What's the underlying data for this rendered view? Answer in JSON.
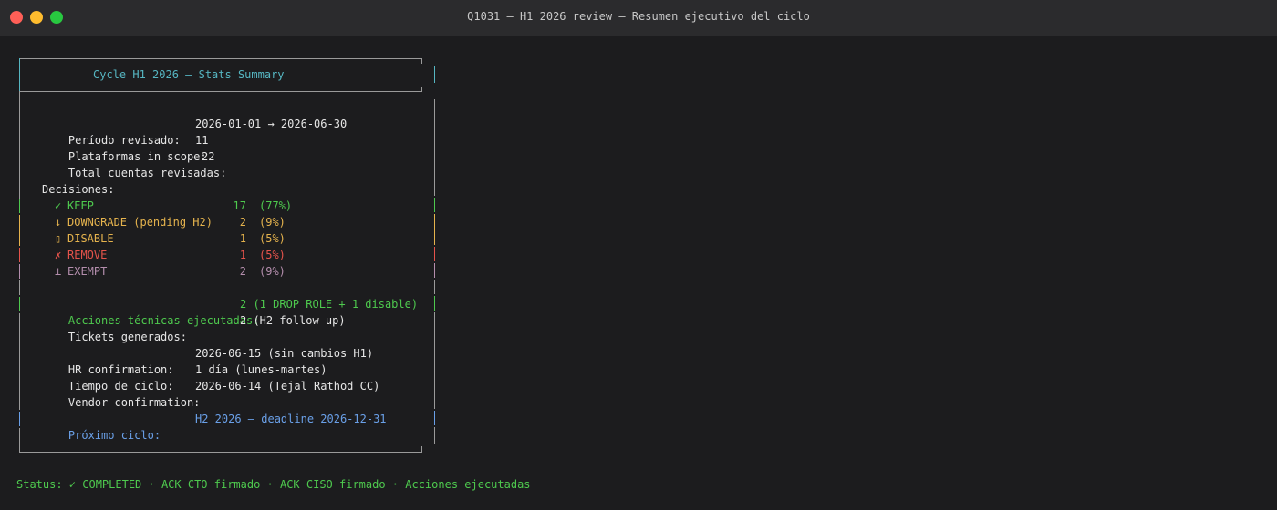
{
  "window": {
    "title": "Q1031 — H1 2026 review — Resumen ejecutivo del ciclo"
  },
  "colors": {
    "background": "#1c1c1e",
    "text": "#e6e6e6",
    "cyan": "#56b6c2",
    "green": "#4ec94e",
    "amber": "#e5b34d",
    "red": "#e5534b",
    "purple": "#b48ead",
    "blue": "#6aa0e8"
  },
  "summary_box": {
    "title": "Cycle H1 2026 — Stats Summary",
    "periodo_label": "Período revisado:",
    "periodo_value": "2026-01-01 → 2026-06-30",
    "plataformas_label": "Plataformas in scope:",
    "plataformas_value": "11",
    "total_label": "Total cuentas revisadas:",
    "total_value": "22",
    "decisiones_label": "Decisiones:",
    "decisions": [
      {
        "icon": "check-icon",
        "glyph": "✓",
        "label": "KEEP",
        "count": "17",
        "pct": "(77%)",
        "color": "#4ec94e"
      },
      {
        "icon": "arrow-down-icon",
        "glyph": "↓",
        "label": "DOWNGRADE (pending H2)",
        "count": "2",
        "pct": "(9%)",
        "color": "#e5b34d"
      },
      {
        "icon": "unknown-glyph-icon",
        "glyph": "▯",
        "label": "DISABLE",
        "count": "1",
        "pct": "(5%)",
        "color": "#e5b34d"
      },
      {
        "icon": "cross-icon",
        "glyph": "✗",
        "label": "REMOVE",
        "count": "1",
        "pct": "(5%)",
        "color": "#e5534b"
      },
      {
        "icon": "perpendicular-icon",
        "glyph": "⊥",
        "label": "EXEMPT",
        "count": "2",
        "pct": "(9%)",
        "color": "#b48ead"
      }
    ],
    "acciones_label": "Acciones técnicas ejecutadas:",
    "acciones_value": "2 (1 DROP ROLE + 1 disable)",
    "tickets_label": "Tickets generados:",
    "tickets_value": "2 (H2 follow-up)",
    "hr_label": "HR confirmation:",
    "hr_value": "2026-06-15 (sin cambios H1)",
    "tiempo_label": "Tiempo de ciclo:",
    "tiempo_value": "1 día (lunes-martes)",
    "vendor_label": "Vendor confirmation:",
    "vendor_value": "2026-06-14 (Tejal Rathod CC)",
    "proximo_label": "Próximo ciclo:",
    "proximo_value": "H2 2026 — deadline 2026-12-31"
  },
  "status_line": "Status: ✓ COMPLETED · ACK CTO firmado · ACK CISO firmado · Acciones ejecutadas"
}
